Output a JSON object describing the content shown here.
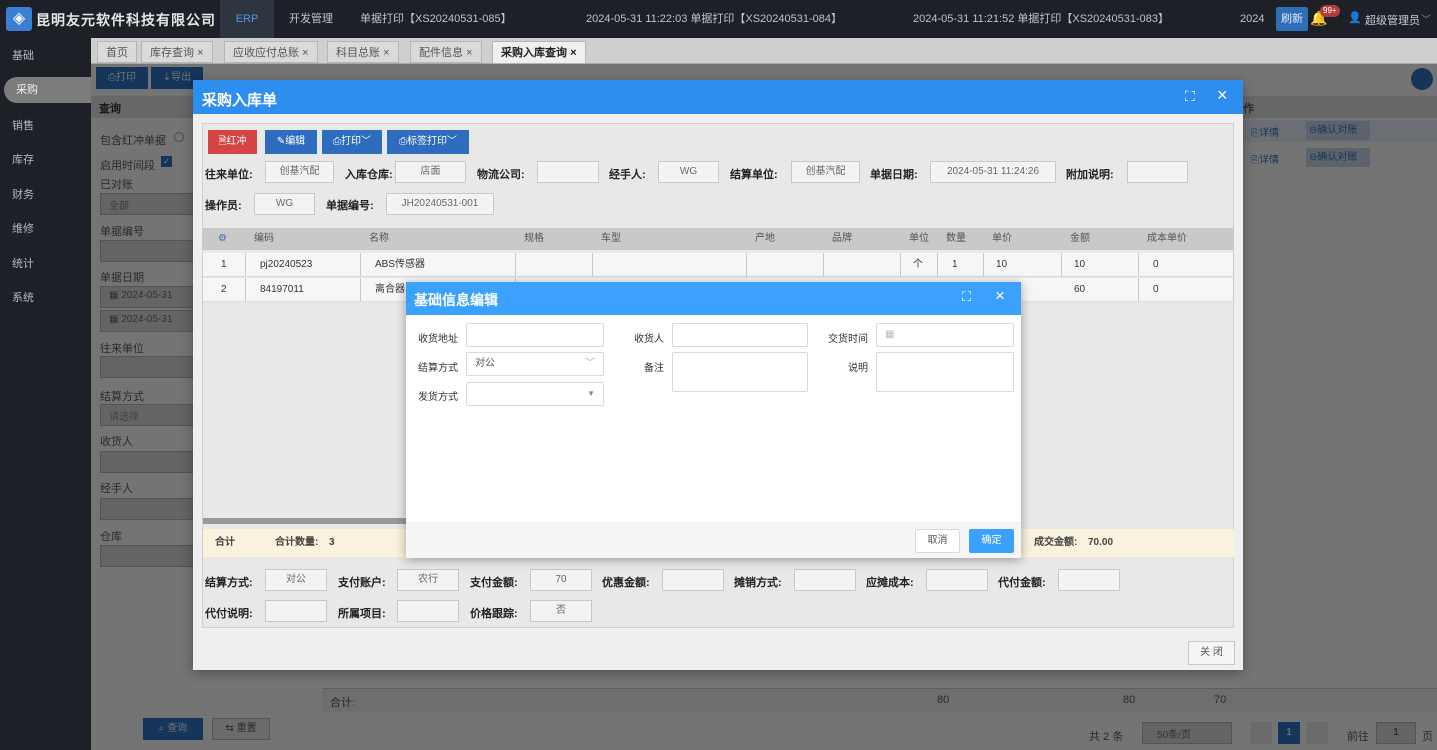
{
  "topbar": {
    "company": "昆明友元软件科技有限公司",
    "nav": [
      {
        "label": "ERP",
        "active": true
      },
      {
        "label": "开发管理"
      },
      {
        "label": "单据打印【XS20240531-085】"
      },
      {
        "label": "2024-05-31 11:22:03 单据打印【XS20240531-084】"
      },
      {
        "label": "2024-05-31 11:21:52 单据打印【XS20240531-083】"
      },
      {
        "label": "2024"
      }
    ],
    "refresh": "刷新",
    "badge": "99+",
    "user": "超级管理员"
  },
  "sidebar": [
    "基础",
    "采购",
    "销售",
    "库存",
    "财务",
    "维修",
    "统计",
    "系统"
  ],
  "tabs": [
    "首页",
    "库存查询",
    "应收应付总账",
    "科目总账",
    "配件信息",
    "采购入库查询"
  ],
  "under": {
    "print": "打印",
    "export": "导出",
    "query_title": "查询",
    "incl_red": "包含红冲单据",
    "enable_time": "启用时间段",
    "reconciled": "已对账",
    "all": "全部",
    "bill_no": "单据编号",
    "bill_date": "单据日期",
    "date1": "2024-05-31",
    "date2": "2024-05-31",
    "partner": "往来单位",
    "settle": "结算方式",
    "please_select": "请选择",
    "receiver": "收货人",
    "handler": "经手人",
    "warehouse": "仓库",
    "query_btn": "查询",
    "reset_btn": "重置",
    "ops": "作",
    "detail": "详情",
    "confirm": "确认对账",
    "sum_label": "合计:",
    "sum1": "80",
    "sum2": "80",
    "sum3": "70",
    "total": "共 2 条",
    "per_page": "50条/页",
    "page": "1",
    "goto": "前往",
    "goto_val": "1",
    "page_suffix": "页"
  },
  "dialog": {
    "title": "采购入库单",
    "buttons": [
      "红冲",
      "编辑",
      "打印",
      "标签打印"
    ],
    "fields": {
      "partner_l": "往来单位:",
      "partner": "创基汽配",
      "wh_l": "入库仓库:",
      "wh": "店面",
      "logistics_l": "物流公司:",
      "handler_l": "经手人:",
      "handler": "WG",
      "settle_l": "结算单位:",
      "settle": "创基汽配",
      "date_l": "单据日期:",
      "date": "2024-05-31 11:24:26",
      "note_l": "附加说明:",
      "op_l": "操作员:",
      "op": "WG",
      "no_l": "单据编号:",
      "no": "JH20240531-001"
    },
    "grid_headers": [
      "编码",
      "名称",
      "规格",
      "车型",
      "产地",
      "品牌",
      "单位",
      "数量",
      "单价",
      "金额",
      "成本单价"
    ],
    "rows": [
      {
        "idx": "1",
        "code": "pj20240523",
        "name": "ABS传感器",
        "spec": "",
        "model": "",
        "origin": "",
        "brand": "",
        "unit": "个",
        "qty": "1",
        "price": "10",
        "amount": "10",
        "cost": "0"
      },
      {
        "idx": "2",
        "code": "84197011",
        "name": "离合器",
        "spec": "",
        "model": "",
        "origin": "",
        "brand": "",
        "unit": "",
        "qty": "",
        "price": "",
        "amount": "60",
        "cost": "0"
      }
    ],
    "summary": {
      "label": "合计",
      "qty_label": "合计数量:",
      "qty": "3",
      "cost_label": "成交金额:",
      "cost": "70.00"
    },
    "bottom": {
      "settle_l": "结算方式:",
      "settle": "对公",
      "account_l": "支付账户:",
      "account": "农行",
      "paid_l": "支付金额:",
      "paid": "70",
      "discount_l": "优惠金额:",
      "amort_l": "摊销方式:",
      "amort_cost_l": "应摊成本:",
      "proxy_l": "代付金额:",
      "proxy_note_l": "代付说明:",
      "project_l": "所属项目:",
      "trace_l": "价格跟踪:",
      "trace": "否"
    },
    "close": "关 闭"
  },
  "modal": {
    "title": "基础信息编辑",
    "addr_l": "收货地址",
    "receiver_l": "收货人",
    "deal_time_l": "交货时间",
    "settle_l": "结算方式",
    "settle": "对公",
    "remark_l": "备注",
    "desc_l": "说明",
    "ship_l": "发货方式",
    "cancel": "取消",
    "ok": "确定"
  }
}
